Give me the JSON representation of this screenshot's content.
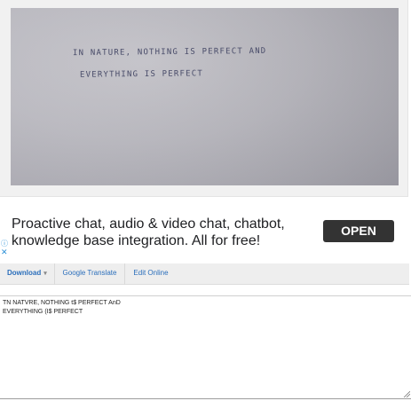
{
  "photo": {
    "handwritten_line1": "IN  NATURE,  NOTHING  IS  PERFECT  AND",
    "handwritten_line2": "EVERYTHING  IS  PERFECT"
  },
  "ad": {
    "text": "Proactive chat, audio & video chat, chatbot, knowledge base integration. All for free!",
    "button_label": "OPEN",
    "info_icon": "ⓘ",
    "close_icon": "✕"
  },
  "toolbar": {
    "download_label": "Download",
    "download_caret": "▾",
    "translate_label": "Google Translate",
    "edit_label": "Edit Online"
  },
  "ocr": {
    "line1": "TN NATVRE, NOTHING t$ PERFECT AnD",
    "line2": "EVERYTHING (I$ PERFECT"
  }
}
